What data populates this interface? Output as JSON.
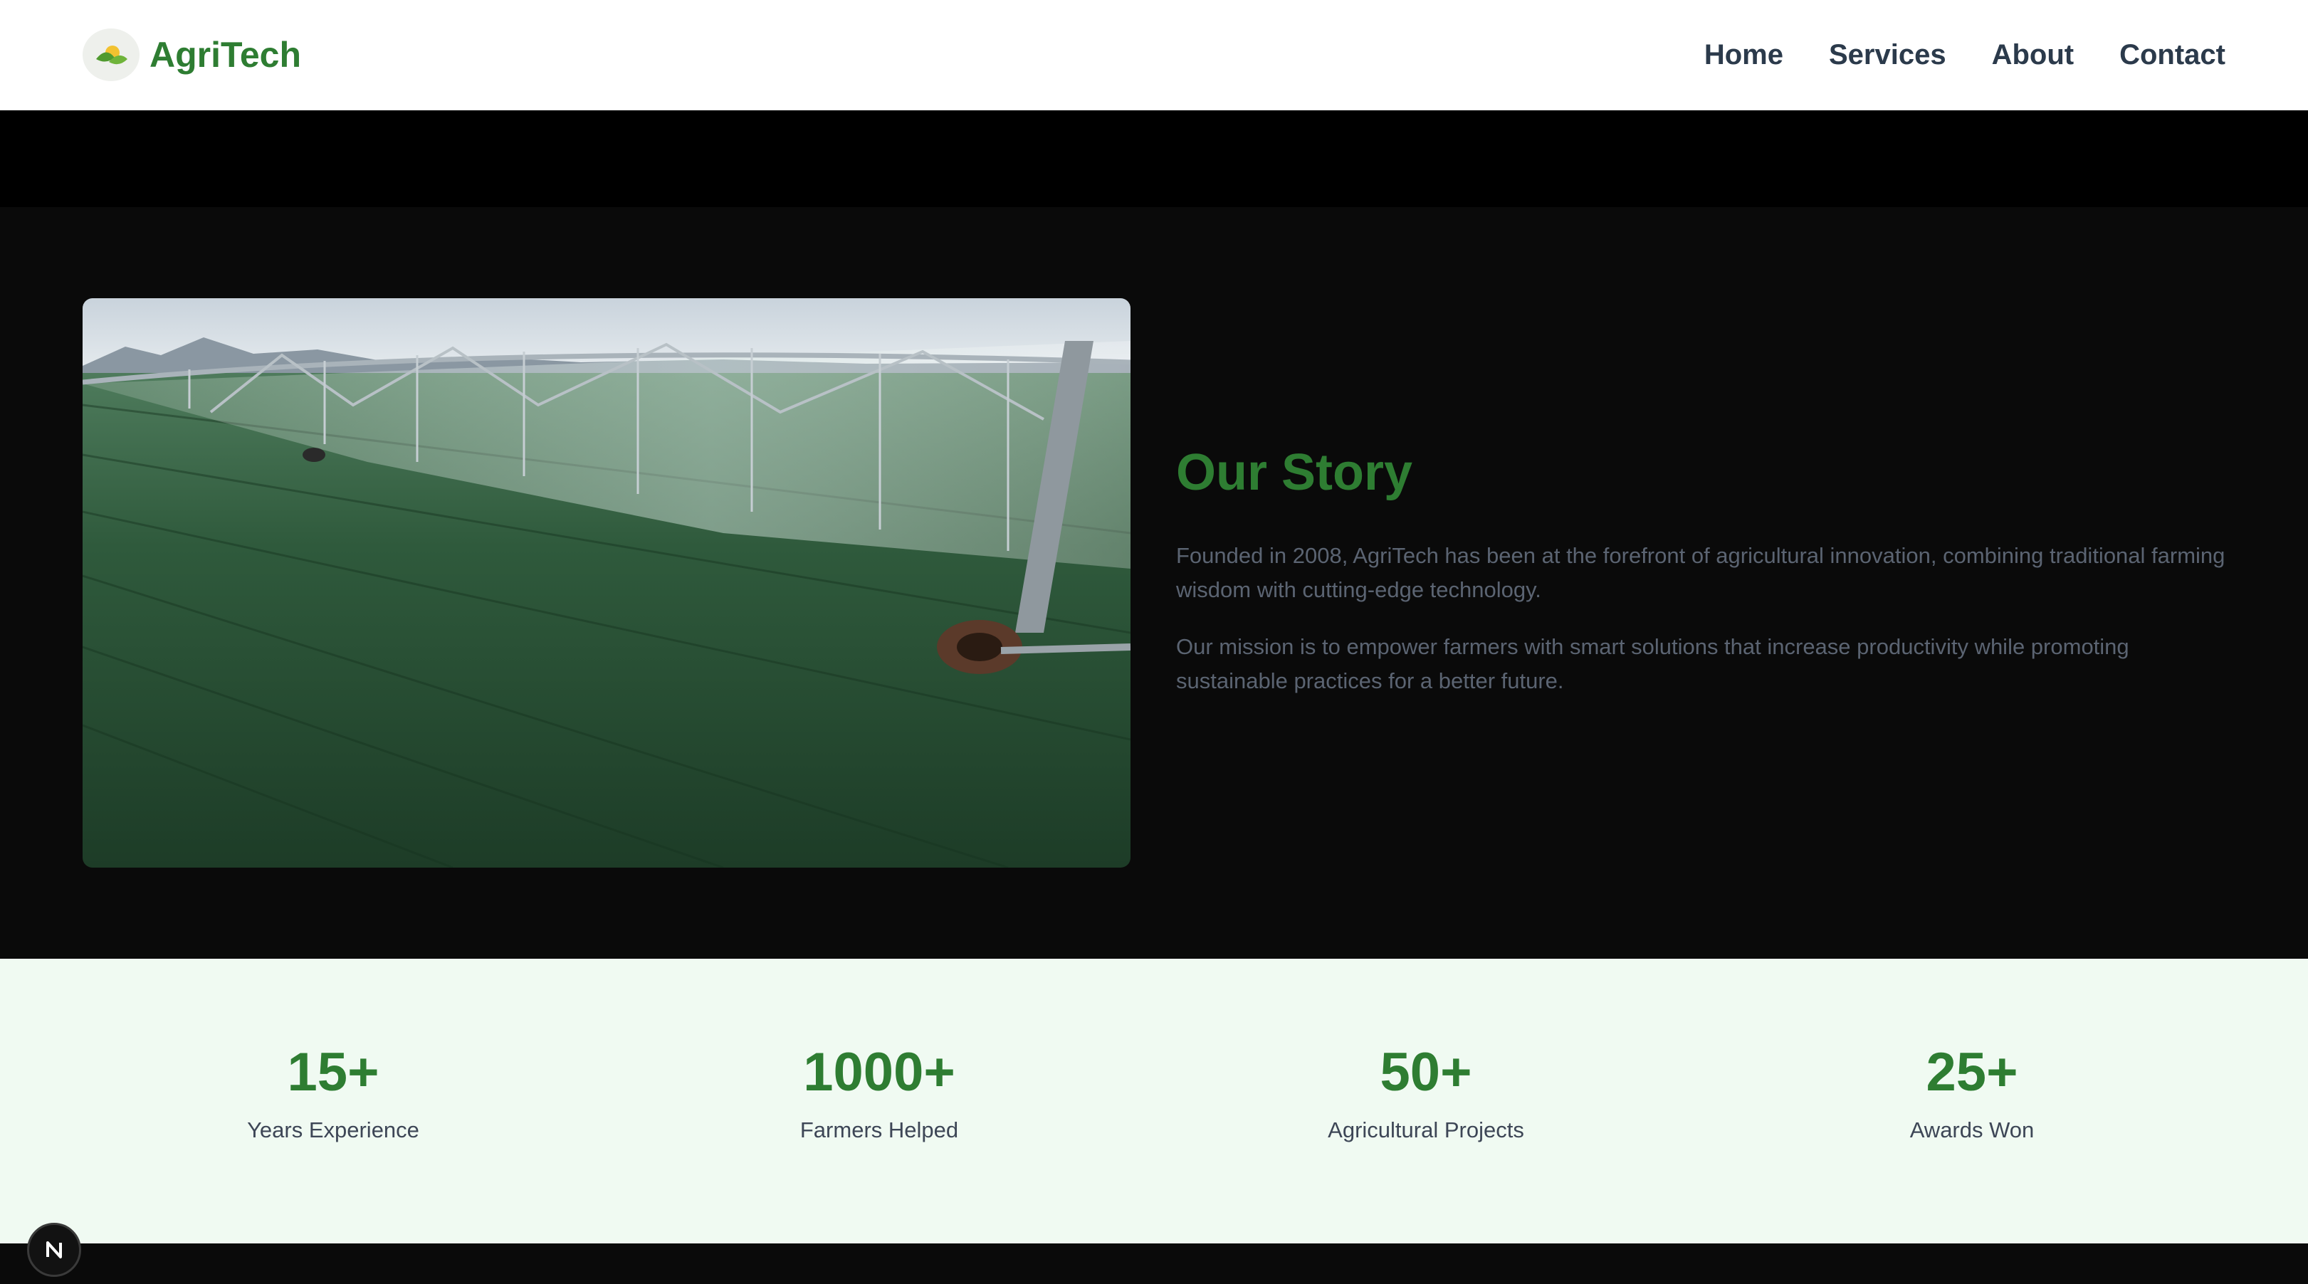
{
  "header": {
    "logo_text": "AgriTech",
    "nav": [
      "Home",
      "Services",
      "About",
      "Contact"
    ]
  },
  "story": {
    "title": "Our Story",
    "paragraphs": [
      "Founded in 2008, AgriTech has been at the forefront of agricultural innovation, combining traditional farming wisdom with cutting-edge technology.",
      "Our mission is to empower farmers with smart solutions that increase productivity while promoting sustainable practices for a better future."
    ],
    "image_icon": "irrigation-field-photo"
  },
  "stats": [
    {
      "value": "15+",
      "label": "Years Experience"
    },
    {
      "value": "1000+",
      "label": "Farmers Helped"
    },
    {
      "value": "50+",
      "label": "Agricultural Projects"
    },
    {
      "value": "25+",
      "label": "Awards Won"
    }
  ],
  "colors": {
    "brand_green": "#2e7d32",
    "nav_text": "#2b3a4b",
    "stats_bg": "#f0faf2",
    "dark_bg": "#0a0a0a"
  },
  "dev_badge_icon": "next-logo-icon"
}
